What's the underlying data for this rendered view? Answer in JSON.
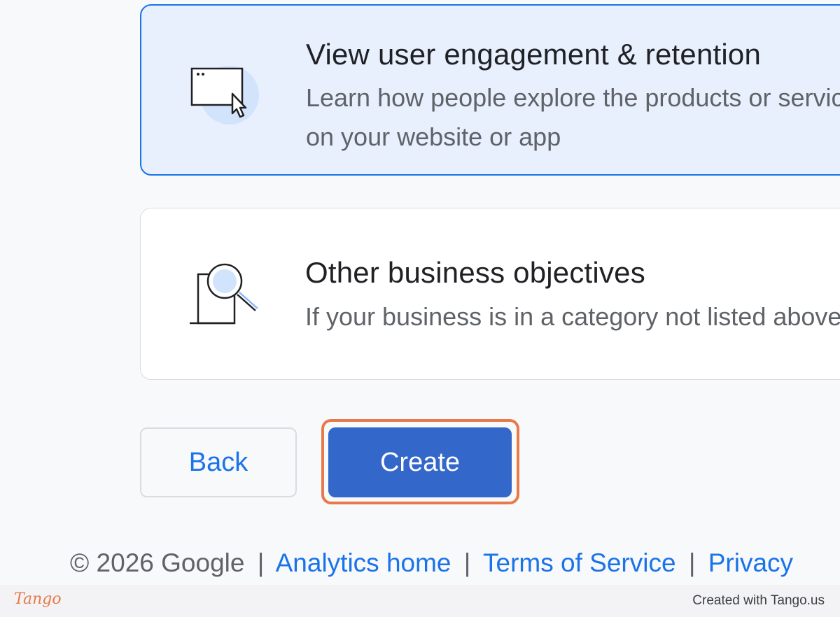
{
  "options": [
    {
      "title": "View user engagement & retention",
      "description": "Learn how people explore the products or services on your website or app",
      "icon": "browser-window-cursor-icon",
      "selected": true
    },
    {
      "title": "Other business objectives",
      "description": "If your business is in a category not listed above",
      "icon": "magnifier-document-icon",
      "selected": false
    }
  ],
  "buttons": {
    "back_label": "Back",
    "create_label": "Create"
  },
  "footer": {
    "copyright": "© 2026 Google",
    "links": [
      "Analytics home",
      "Terms of Service",
      "Privacy"
    ],
    "separator": "|"
  },
  "tango": {
    "logo": "Tango",
    "credit": "Created with Tango.us"
  },
  "colors": {
    "accent": "#1a73e8",
    "create_button": "#3367c9",
    "highlight_ring": "#e8794a",
    "selected_card_bg": "#e8f0fe"
  }
}
